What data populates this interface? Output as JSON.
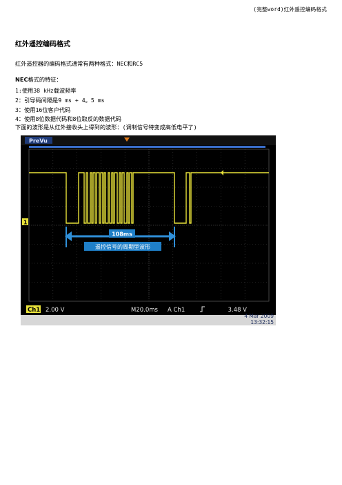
{
  "header": "(完整word)红外遥控编码格式",
  "title": "红外遥控编码格式",
  "intro": "红外遥控器的编码格式通常有两种格式：NEC和RC5",
  "nec_heading_bold": "NEC",
  "nec_heading_rest": "格式的特征：",
  "features": [
    "1:使用38 kHz载波频率",
    "2：引导码间隔是9 ms + 4。5 ms",
    "3：使用16位客户代码",
    "4：使用8位数据代码和8位取反的数据代码"
  ],
  "waveform_caption": "下面的波形是从红外接收头上得到的波形：(调制信号特变成高低电平了)",
  "scope": {
    "mode_label": "PreVu",
    "channel_marker": "1",
    "period_label": "108ms",
    "period_caption": "遥控信号的周期型波形",
    "ch_label": "Ch1",
    "volts_div": "2.00 V",
    "timebase": "M20.0ms",
    "trigger": "A  Ch1",
    "trigger_slope_icon": "rising-edge",
    "trigger_level": "3.48 V",
    "date": "4 Mar 2009",
    "time": "13:32:15",
    "trace_color": "#e8e23a",
    "arrow_color": "#2f8fd8",
    "label_bg": "#1f7fc8"
  }
}
